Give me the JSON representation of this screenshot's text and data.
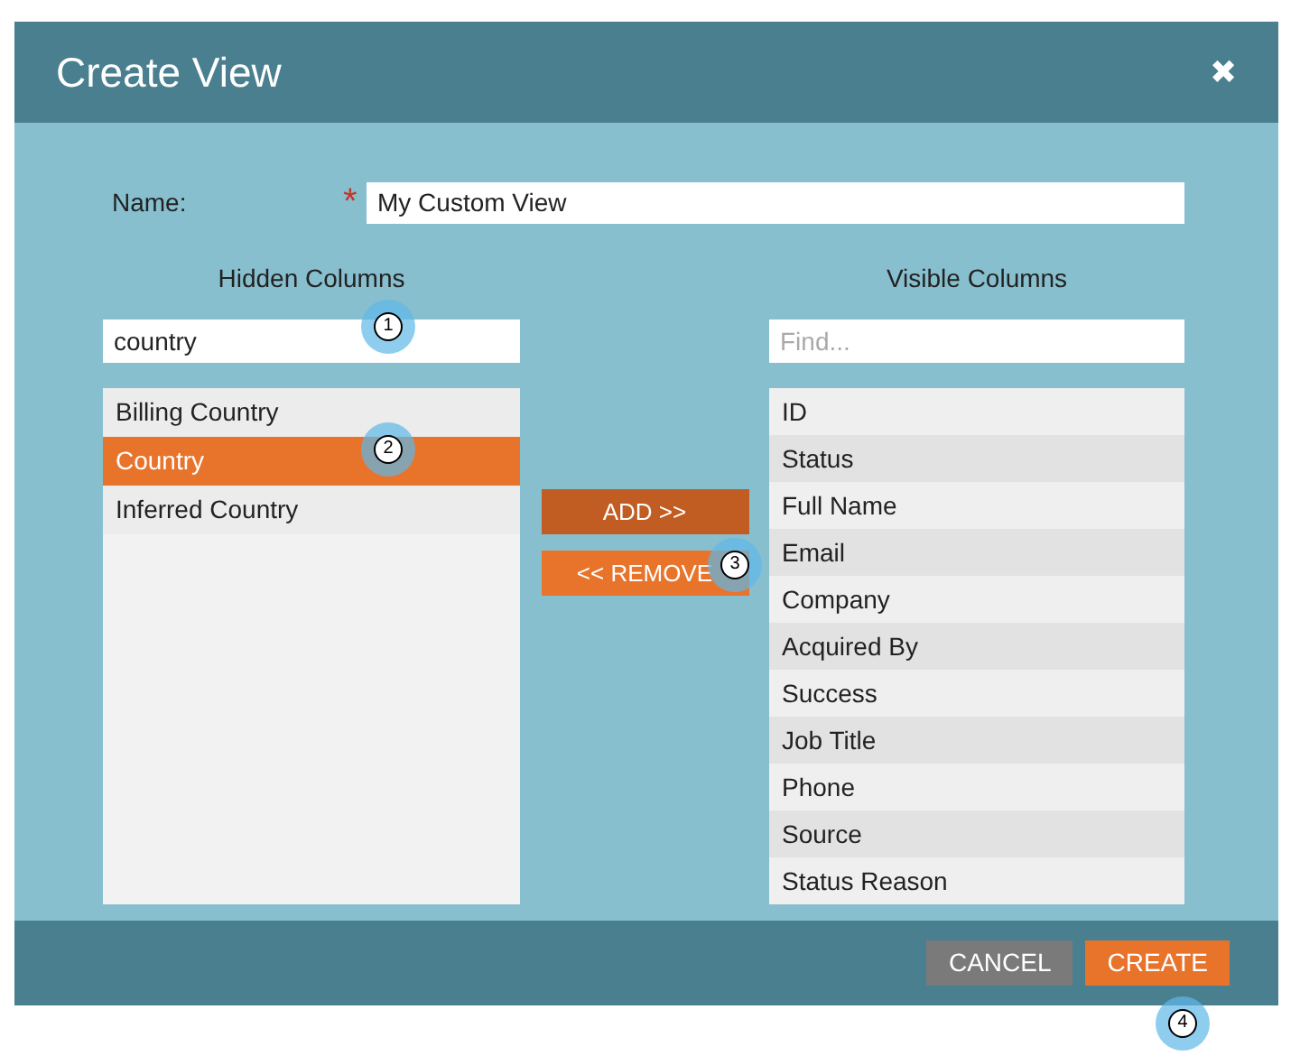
{
  "dialog": {
    "title": "Create View",
    "close": "✖"
  },
  "name_field": {
    "label": "Name:",
    "required": "*",
    "value": "My Custom View"
  },
  "hidden_columns": {
    "title": "Hidden Columns",
    "search_value": "country",
    "items": [
      {
        "label": "Billing Country",
        "selected": false
      },
      {
        "label": "Country",
        "selected": true
      },
      {
        "label": "Inferred Country",
        "selected": false
      }
    ]
  },
  "transfer_buttons": [
    {
      "label": "ADD >>",
      "kind": "add"
    },
    {
      "label": "<< REMOVE",
      "kind": "remove"
    }
  ],
  "visible_columns": {
    "title": "Visible Columns",
    "search_placeholder": "Find...",
    "items": [
      "ID",
      "Status",
      "Full Name",
      "Email",
      "Company",
      "Acquired By",
      "Success",
      "Job Title",
      "Phone",
      "Source",
      "Status Reason"
    ]
  },
  "footer_buttons": [
    {
      "label": "CANCEL",
      "kind": "secondary"
    },
    {
      "label": "CREATE",
      "kind": "primary"
    }
  ],
  "steps": [
    "1",
    "2",
    "3",
    "4"
  ]
}
